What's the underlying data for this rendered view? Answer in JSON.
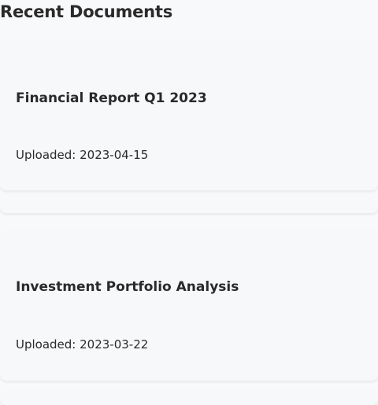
{
  "section": {
    "title": "Recent Documents"
  },
  "documents": [
    {
      "icon": "document-icon",
      "name": "Financial Report Q1 2023",
      "uploaded": "Uploaded: 2023-04-15"
    },
    {
      "icon": "document-icon",
      "name": "Investment Portfolio Analysis",
      "uploaded": "Uploaded: 2023-03-22"
    }
  ]
}
